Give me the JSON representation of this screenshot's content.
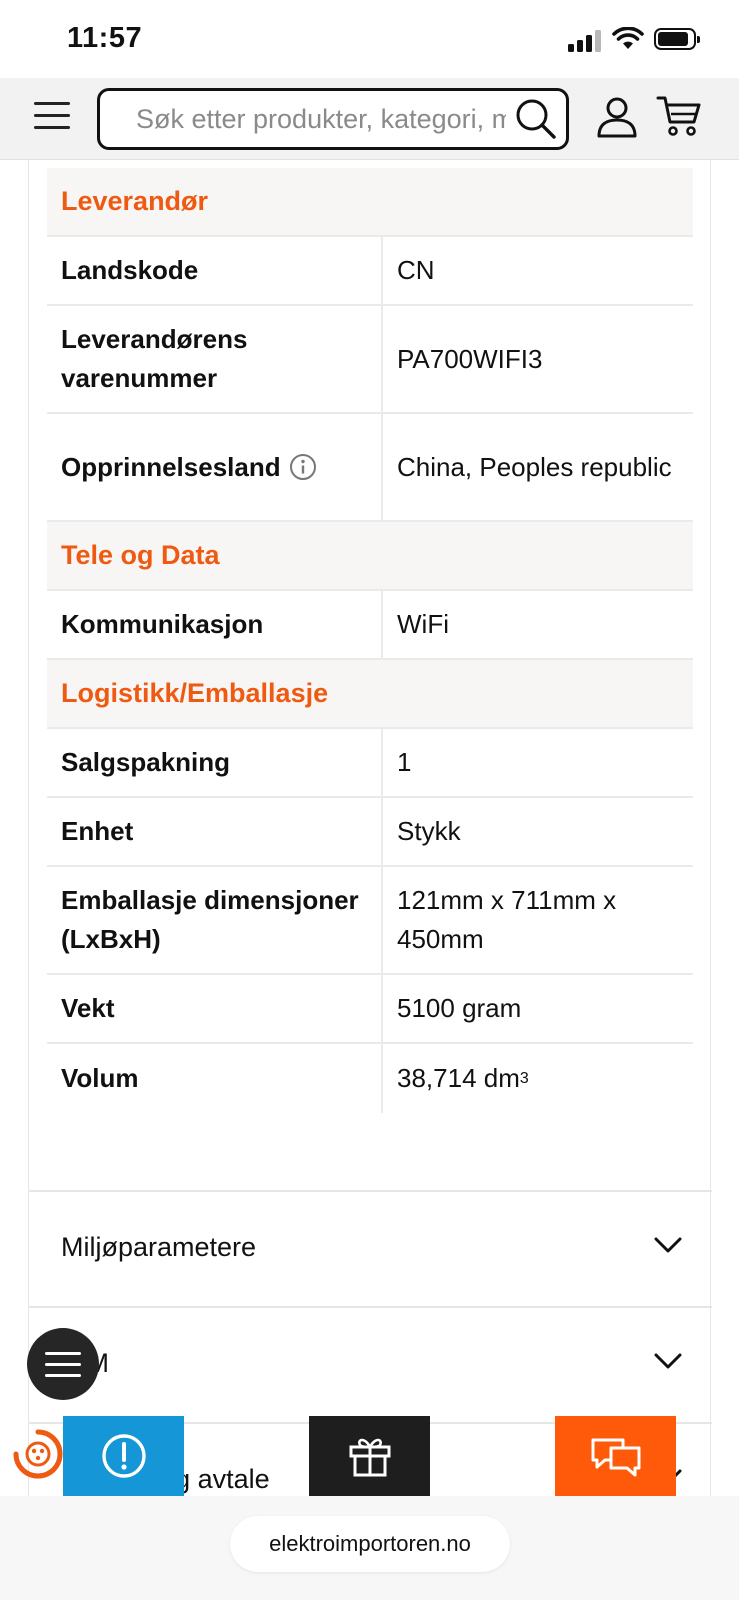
{
  "status_bar": {
    "time": "11:57"
  },
  "header": {
    "search_placeholder": "Søk etter produkter, kategori, merke"
  },
  "spec_sections": [
    {
      "title": "Leverandør",
      "rows": [
        {
          "key": "Landskode",
          "value": "CN"
        },
        {
          "key": "Leverandørens varenummer",
          "value": "PA700WIFI3"
        },
        {
          "key": "Opprinnelsesland",
          "value": "China, Peoples republic"
        }
      ]
    },
    {
      "title": "Tele og Data",
      "rows": [
        {
          "key": "Kommunikasjon",
          "value": "WiFi"
        }
      ]
    },
    {
      "title": "Logistikk/Emballasje",
      "rows": [
        {
          "key": "Salgspakning",
          "value": "1"
        },
        {
          "key": "Enhet",
          "value": "Stykk"
        },
        {
          "key": "Emballasje dimensjoner (LxBxH)",
          "value": "121mm x 711mm x 450mm"
        },
        {
          "key": "Vekt",
          "value": "5100 gram"
        },
        {
          "key": "Volum",
          "value": "38,714 dm",
          "value_sup": "3"
        }
      ]
    }
  ],
  "accordions": [
    {
      "label": "Miljøparametere"
    },
    {
      "label": "BIM"
    },
    {
      "label": "Kontakt og avtale"
    }
  ],
  "browser": {
    "url": "elektroimportoren.no"
  },
  "colors": {
    "accent_orange": "#ef5a12",
    "feedback_blue": "#1596d6",
    "chat_orange": "#ff5a0a"
  }
}
